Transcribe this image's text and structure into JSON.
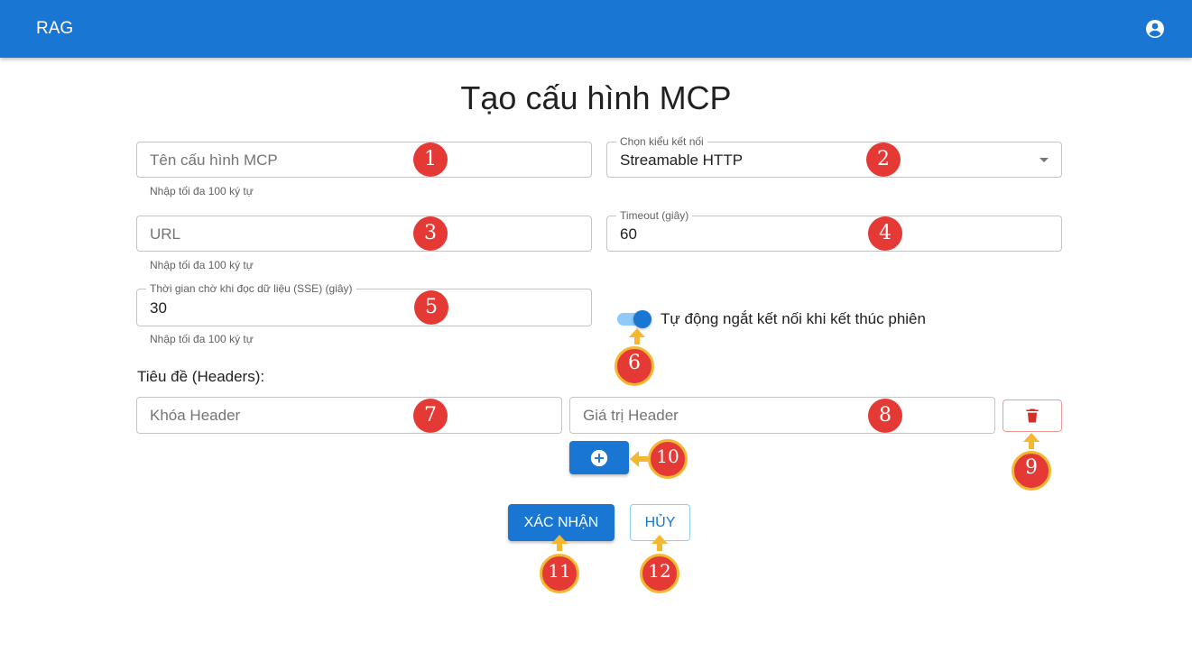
{
  "appbar": {
    "title": "RAG",
    "account_icon": "account-circle-icon"
  },
  "page": {
    "title": "Tạo cấu hình MCP"
  },
  "form": {
    "name": {
      "placeholder": "Tên cấu hình MCP",
      "helper": "Nhập tối đa 100 ký tự"
    },
    "connection_type": {
      "label": "Chọn kiểu kết nối",
      "value": "Streamable HTTP"
    },
    "url": {
      "placeholder": "URL",
      "helper": "Nhập tối đa 100 ký tự"
    },
    "timeout": {
      "label": "Timeout (giây)",
      "value": "60"
    },
    "sse_read_timeout": {
      "label": "Thời gian chờ khi đọc dữ liệu (SSE) (giây)",
      "value": "30",
      "helper": "Nhập tối đa 100 ký tự"
    },
    "auto_disconnect": {
      "label": "Tự động ngắt kết nối khi kết thúc phiên",
      "checked": true
    },
    "headers_title": "Tiêu đề (Headers):",
    "header_key": {
      "placeholder": "Khóa Header"
    },
    "header_value": {
      "placeholder": "Giá trị Header"
    },
    "delete_icon": "trash-icon",
    "add_icon": "plus-circle-icon"
  },
  "actions": {
    "confirm": "XÁC NHẬN",
    "cancel": "HỦY"
  },
  "annotations": [
    "1",
    "2",
    "3",
    "4",
    "5",
    "6",
    "7",
    "8",
    "9",
    "10",
    "11",
    "12"
  ],
  "colors": {
    "primary": "#1976d2",
    "annotation_badge": "#e53935",
    "annotation_ring": "#f4b731",
    "delete": "#d32f2f"
  }
}
